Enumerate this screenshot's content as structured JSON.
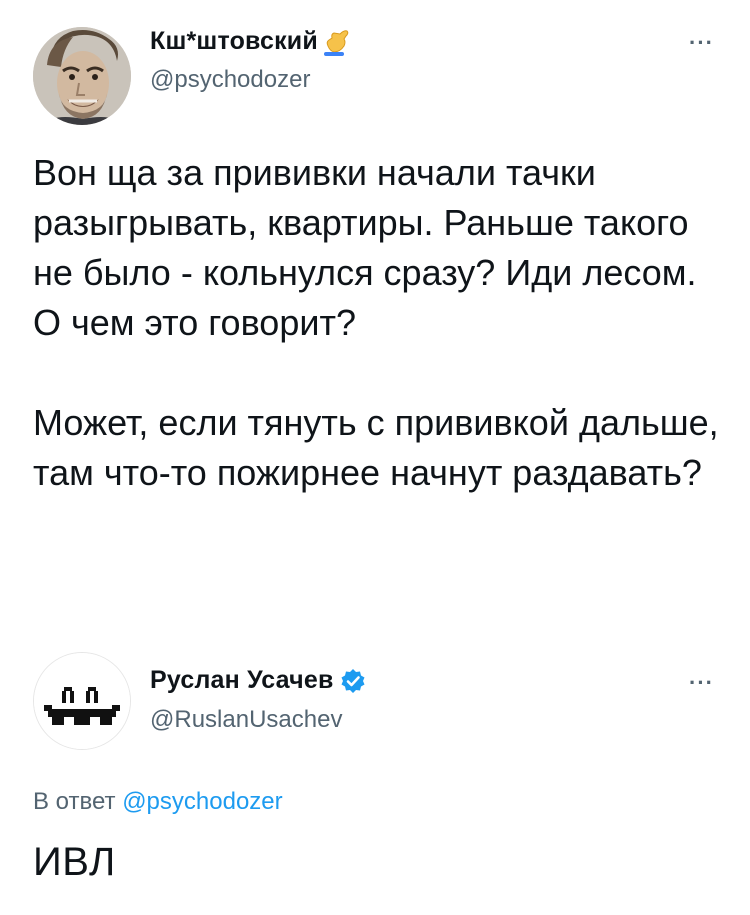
{
  "tweet1": {
    "display_name": "Кш*штовский",
    "name_emoji": "hand-emoji-icon",
    "handle": "@psychodozer",
    "more_label": "···",
    "paragraphs": [
      "Вон ща за прививки начали тачки разыгрывать, квартиры. Раньше такого не было - кольнулся сразу? Иди лесом. О чем это говорит?",
      "Может, если тянуть с прививкой дальше, там что-то пожирнее начнут раздавать?"
    ]
  },
  "tweet2": {
    "display_name": "Руслан Усачев",
    "handle": "@RuslanUsachev",
    "more_label": "···",
    "reply_prefix": "В ответ",
    "reply_mention": "@psychodozer",
    "text": "ИВЛ"
  },
  "colors": {
    "secondary_text": "#536471",
    "link": "#1d9bf0",
    "verified": "#1d9bf0",
    "primary_text": "#0f1419"
  }
}
